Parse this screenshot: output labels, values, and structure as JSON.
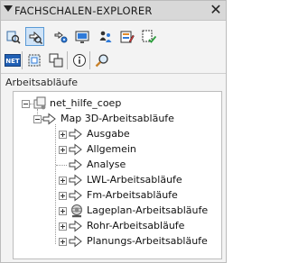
{
  "panel": {
    "title": "FACHSCHALEN-EXPLORER",
    "close_glyph": "✕"
  },
  "toolbar": {
    "row1": [
      {
        "name": "workspace-map-icon",
        "active": false
      },
      {
        "name": "workflows-icon",
        "active": true
      },
      {
        "name": "settings-tree-icon",
        "active": false
      },
      {
        "name": "display-manager-icon",
        "active": false
      },
      {
        "name": "user-admin-icon",
        "active": false
      },
      {
        "name": "edit-form-icon",
        "active": false
      },
      {
        "name": "check-list-icon",
        "active": false
      }
    ],
    "row2": [
      {
        "name": "dotnet-icon",
        "badge_text": "NET"
      },
      {
        "name": "select-frame-icon"
      },
      {
        "name": "copy-objects-icon"
      },
      {
        "name": "info-icon"
      },
      {
        "name": "search-magnifier-icon"
      }
    ]
  },
  "section": {
    "label": "Arbeitsabläufe"
  },
  "tree": {
    "root": {
      "label": "net_hilfe_coep",
      "expanded": true
    },
    "group": {
      "label": "Map 3D-Arbeitsabläufe",
      "expanded": true
    },
    "items": [
      {
        "label": "Ausgabe",
        "expandable": true,
        "icon": "workflow-arrow-icon"
      },
      {
        "label": "Allgemein",
        "expandable": true,
        "icon": "workflow-arrow-icon"
      },
      {
        "label": "Analyse",
        "expandable": false,
        "icon": "workflow-arrow-icon"
      },
      {
        "label": "LWL-Arbeitsabläufe",
        "expandable": true,
        "icon": "workflow-arrow-icon"
      },
      {
        "label": "Fm-Arbeitsabläufe",
        "expandable": true,
        "icon": "workflow-arrow-icon"
      },
      {
        "label": "Lageplan-Arbeitsabläufe",
        "expandable": true,
        "icon": "globe-gear-icon"
      },
      {
        "label": "Rohr-Arbeitsabläufe",
        "expandable": true,
        "icon": "workflow-arrow-icon"
      },
      {
        "label": "Planungs-Arbeitsabläufe",
        "expandable": true,
        "icon": "workflow-arrow-icon"
      }
    ]
  },
  "colors": {
    "accent": "#2f7ad8",
    "active_button_bg": "#cfe3f7",
    "title_bg": "#d8d8d8"
  }
}
